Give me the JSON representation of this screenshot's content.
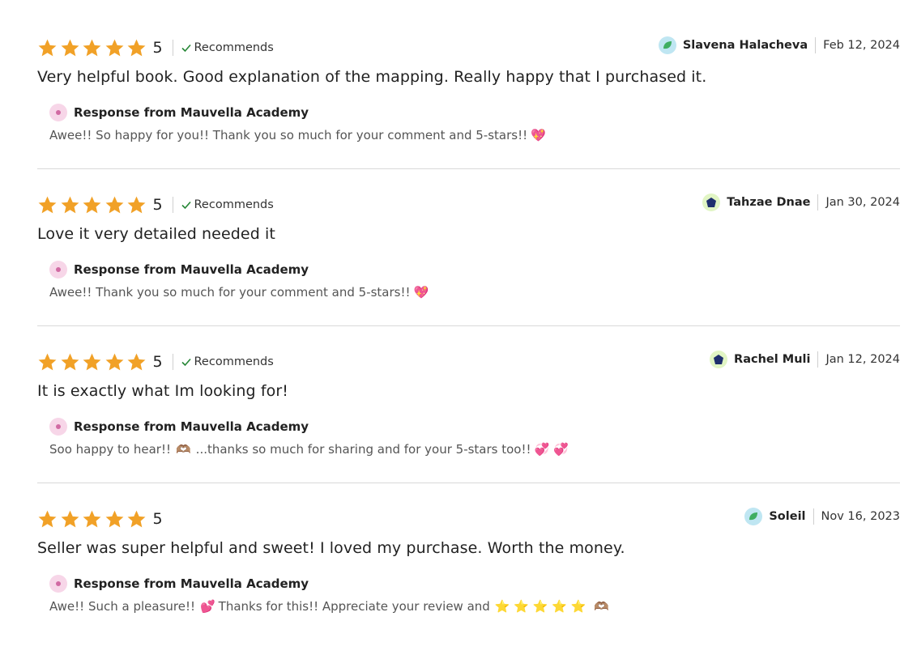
{
  "reviews": [
    {
      "rating": "5",
      "recommends_label": "Recommends",
      "reviewer_name": "Slavena Halacheva",
      "date": "Feb 12, 2024",
      "text": "Very helpful book. Good explanation of the mapping. Really happy that I purchased it.",
      "response_title": "Response from Mauvella Academy",
      "response_text": "Awee!! So happy for you!! Thank you so much for your comment and 5-stars!!",
      "response_emoji": "💖"
    },
    {
      "rating": "5",
      "recommends_label": "Recommends",
      "reviewer_name": "Tahzae Dnae",
      "date": "Jan 30, 2024",
      "text": "Love it very detailed needed it",
      "response_title": "Response from Mauvella Academy",
      "response_text": "Awee!! Thank you so much for your comment and 5-stars!!",
      "response_emoji": "💖"
    },
    {
      "rating": "5",
      "recommends_label": "Recommends",
      "reviewer_name": "Rachel Muli",
      "date": "Jan 12, 2024",
      "text": "It is exactly what Im looking for!",
      "response_title": "Response from Mauvella Academy",
      "response_text_a": "Soo happy to hear!!",
      "response_emoji_a": "🫶🏽",
      "response_text_b": "...thanks so much for sharing and for your 5-stars too!!",
      "response_emoji_b": "💞 💞"
    },
    {
      "rating": "5",
      "reviewer_name": "Soleil",
      "date": "Nov 16, 2023",
      "text": "Seller was super helpful and sweet! I loved my purchase. Worth the money.",
      "response_title": "Response from Mauvella Academy",
      "response_text_a": "Awe!! Such a pleasure!!",
      "response_emoji_a": "💕",
      "response_text_b": "Thanks for this!! Appreciate your review and",
      "response_emoji_b": "⭐ ⭐ ⭐ ⭐ ⭐",
      "response_emoji_c": "🫶🏽"
    }
  ],
  "colors": {
    "star": "#f1a127",
    "check": "#258635",
    "divider": "#d9d9d9",
    "avatar_teal_bg": "#bfe6f2",
    "avatar_teal_fg": "#3fae62",
    "avatar_lime_bg": "#e1f5c4",
    "avatar_lime_fg": "#1f2f6e"
  },
  "icons": {
    "star": "star-icon",
    "check": "check-icon",
    "reviewer_avatar_teal": "leaf-avatar-icon",
    "reviewer_avatar_lime": "pentagon-avatar-icon",
    "shop_avatar": "shop-logo-icon"
  }
}
